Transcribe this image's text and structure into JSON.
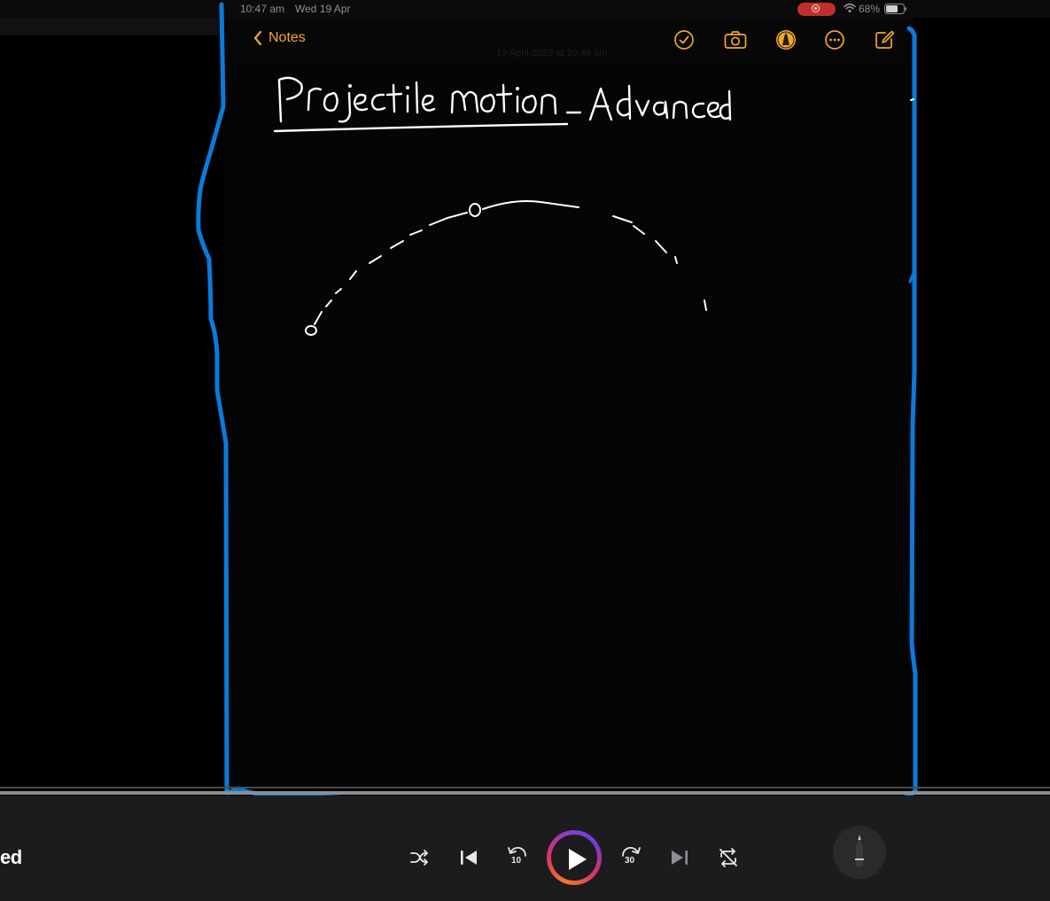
{
  "status_bar": {
    "time": "10:47 am",
    "date": "Wed 19 Apr",
    "battery": "68%"
  },
  "toolbar": {
    "back_label": "Notes",
    "note_date": "19 April 2023 at 10:46 am",
    "icons": [
      "checklist-icon",
      "camera-icon",
      "markup-icon",
      "more-icon",
      "compose-icon"
    ]
  },
  "note": {
    "title": "Projectile Motion - Advanced"
  },
  "player": {
    "track_title": "ed",
    "skip_back_seconds": "10",
    "skip_forward_seconds": "30",
    "controls": [
      "shuffle-icon",
      "previous-icon",
      "skip-back-icon",
      "play-icon",
      "skip-forward-icon",
      "next-icon",
      "repeat-icon"
    ]
  },
  "colors": {
    "accent": "#f5a623",
    "annotation_blue": "#0a7bdc",
    "ink": "#ffffff",
    "background": "#000000",
    "player_bg": "#1c1c1e"
  }
}
